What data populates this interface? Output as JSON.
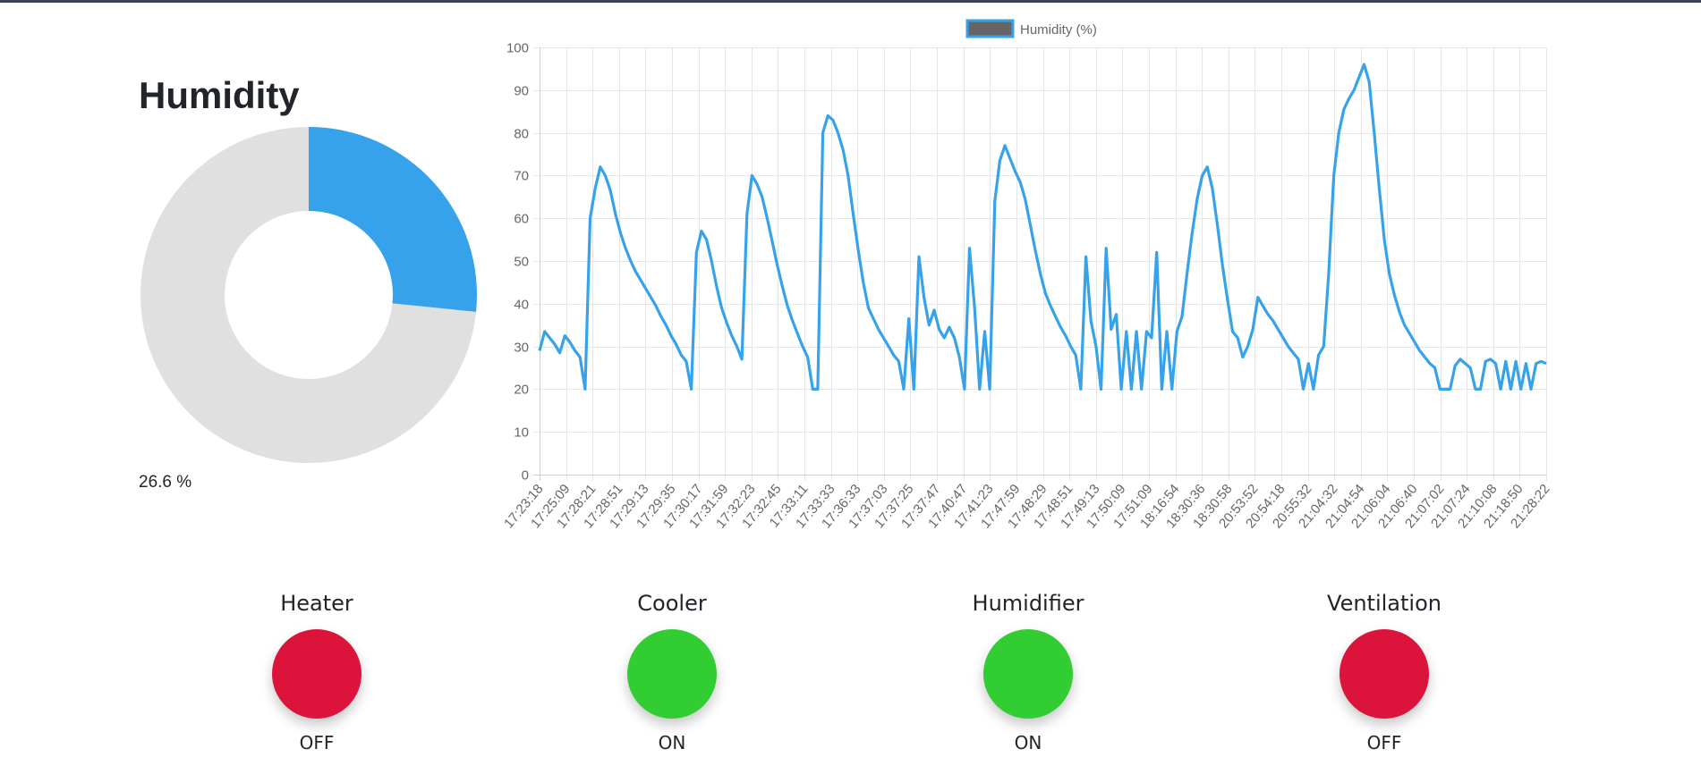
{
  "page": {
    "title": "Humidity",
    "humidity_value": "26.6 %"
  },
  "colors": {
    "accent": "#36a2eb",
    "donut_rest": "#e0e0e0",
    "on": "#32cd32",
    "off": "#dc143c",
    "legend_box_fill": "#666666",
    "legend_box_border": "#36a2eb",
    "grid": "#e6e6e6",
    "tick_text": "#666666"
  },
  "gauge": {
    "value": 26.6,
    "max": 100
  },
  "devices": [
    {
      "name": "Heater",
      "status": "OFF",
      "state": "off"
    },
    {
      "name": "Cooler",
      "status": "ON",
      "state": "on"
    },
    {
      "name": "Humidifier",
      "status": "ON",
      "state": "on"
    },
    {
      "name": "Ventilation",
      "status": "OFF",
      "state": "off"
    }
  ],
  "chart_data": {
    "type": "line",
    "legend": "Humidity (%)",
    "legend_position": "top-center",
    "grid": true,
    "ylim": [
      0,
      100
    ],
    "y_ticks": [
      0,
      10,
      20,
      30,
      40,
      50,
      60,
      70,
      80,
      90,
      100
    ],
    "x_tick_labels": [
      "17:23:18",
      "17:25:09",
      "17:28:21",
      "17:28:51",
      "17:29:13",
      "17:29:35",
      "17:30:17",
      "17:31:59",
      "17:32:23",
      "17:32:45",
      "17:33:11",
      "17:33:33",
      "17:36:33",
      "17:37:03",
      "17:37:25",
      "17:37:47",
      "17:40:47",
      "17:41:23",
      "17:47:59",
      "17:48:29",
      "17:48:51",
      "17:49:13",
      "17:50:09",
      "17:51:09",
      "18:16:54",
      "18:30:36",
      "18:30:58",
      "20:53:52",
      "20:54:18",
      "20:55:32",
      "21:04:32",
      "21:04:54",
      "21:06:04",
      "21:06:40",
      "21:07:02",
      "21:07:24",
      "21:10:08",
      "21:18:50",
      "21:28:22"
    ],
    "series": [
      {
        "name": "Humidity (%)",
        "values": [
          29,
          33.5,
          32,
          30.5,
          28.5,
          32.5,
          31,
          29,
          27.5,
          20,
          60,
          67,
          72,
          70,
          66.5,
          61,
          56.5,
          53,
          50,
          47.5,
          45.5,
          43.5,
          41.5,
          39.5,
          37,
          35,
          32.5,
          30.5,
          28,
          26.5,
          20,
          52,
          57,
          55,
          50,
          44,
          39,
          35.5,
          32.5,
          30,
          27,
          61,
          70,
          68,
          65,
          60,
          54.5,
          49,
          44,
          39.5,
          36,
          33,
          30,
          27.5,
          20,
          20,
          80,
          84,
          83,
          80,
          76,
          70,
          61,
          52.5,
          45,
          39,
          36.5,
          34,
          32,
          30,
          28,
          26.5,
          20,
          36.5,
          20,
          51,
          41.5,
          35,
          38.5,
          34,
          32,
          34.5,
          32,
          27.5,
          20,
          53,
          39,
          20,
          33.5,
          20,
          64,
          73.5,
          77,
          74,
          71,
          68.5,
          64.5,
          58.5,
          52.5,
          47,
          42.5,
          39.5,
          37,
          34.5,
          32.5,
          30,
          28,
          20,
          51,
          36,
          30,
          20,
          53,
          34,
          37.5,
          20,
          33.5,
          20,
          33.5,
          20,
          33.5,
          32,
          52,
          20,
          33.5,
          20,
          33.5,
          37,
          47,
          56.5,
          64.5,
          70,
          72,
          67,
          58.5,
          49,
          41,
          33.5,
          32,
          27.5,
          30,
          34,
          41.5,
          39.5,
          37.5,
          36,
          34,
          32,
          30,
          28.5,
          27,
          20,
          26,
          20,
          28,
          30,
          47,
          70,
          80,
          85.5,
          88,
          90,
          93,
          96,
          92,
          80,
          67,
          55,
          47,
          42,
          38,
          35,
          33,
          31,
          29,
          27.5,
          26,
          25,
          20,
          20,
          20,
          25.5,
          27,
          26,
          25,
          20,
          20,
          26.5,
          27,
          26,
          20,
          26.5,
          20,
          26.5,
          20,
          26,
          20,
          26,
          26.5,
          26
        ]
      }
    ]
  }
}
